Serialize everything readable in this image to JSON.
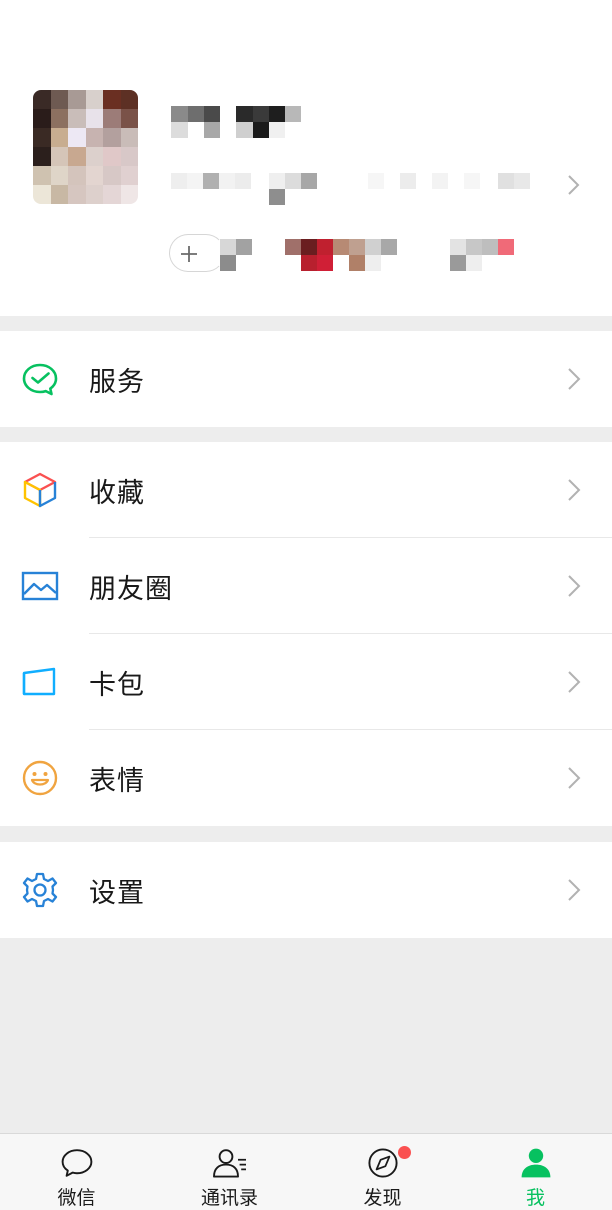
{
  "menu": {
    "services": {
      "label": "服务",
      "icon": "wechat-pay-icon"
    },
    "group2": [
      {
        "label": "收藏",
        "icon": "favorites-cube-icon"
      },
      {
        "label": "朋友圈",
        "icon": "moments-image-icon"
      },
      {
        "label": "卡包",
        "icon": "card-wallet-icon"
      },
      {
        "label": "表情",
        "icon": "sticker-smiley-icon"
      }
    ],
    "settings": {
      "label": "设置",
      "icon": "gear-icon"
    }
  },
  "tabbar": {
    "tabs": [
      {
        "label": "微信",
        "icon": "chat-bubble-icon"
      },
      {
        "label": "通讯录",
        "icon": "contacts-icon"
      },
      {
        "label": "发现",
        "icon": "discover-compass-icon"
      },
      {
        "label": "我",
        "icon": "me-person-icon"
      }
    ],
    "active": "我",
    "discover_badge": true
  },
  "colors": {
    "accent": "#07c160",
    "badge": "#fa5151",
    "background": "#ededed"
  }
}
